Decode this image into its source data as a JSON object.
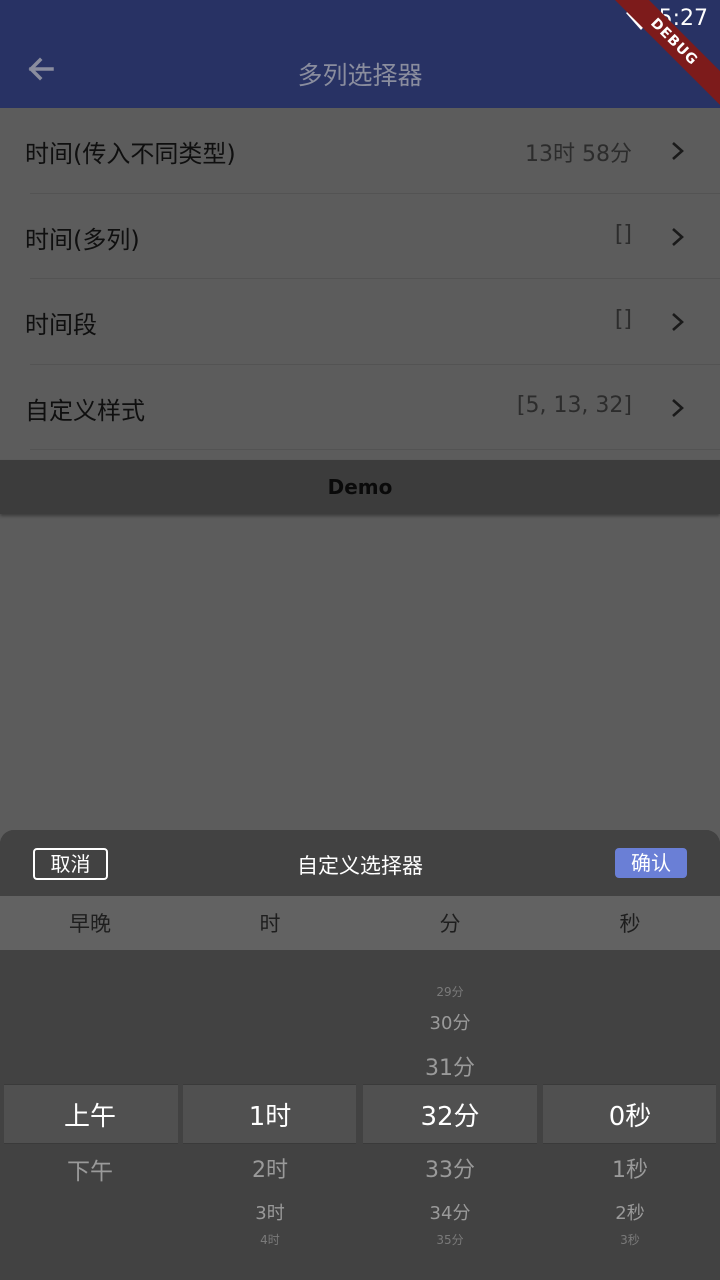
{
  "status_bar": {
    "time": "5:27",
    "debug_label": "DEBUG"
  },
  "app_bar": {
    "title": "多列选择器",
    "back_icon": "arrow-left-icon"
  },
  "list": [
    {
      "label": "时间(传入不同类型)",
      "value": "13时 58分"
    },
    {
      "label": "时间(多列)",
      "value": "[]"
    },
    {
      "label": "时间段",
      "value": "[]"
    },
    {
      "label": "自定义样式",
      "value": "[5, 13, 32]"
    }
  ],
  "demo_button": "Demo",
  "picker": {
    "cancel": "取消",
    "title": "自定义选择器",
    "confirm": "确认",
    "confirm_color": "#6a7fd6",
    "columns": [
      "早晚",
      "时",
      "分",
      "秒"
    ],
    "ampm": {
      "selected": "上午",
      "below1": "下午"
    },
    "hour": {
      "selected": "1时",
      "below1": "2时",
      "below2": "3时",
      "below3": "4时"
    },
    "minute": {
      "above3": "29分",
      "above2": "30分",
      "above1": "31分",
      "selected": "32分",
      "below1": "33分",
      "below2": "34分",
      "below3": "35分"
    },
    "second": {
      "selected": "0秒",
      "below1": "1秒",
      "below2": "2秒",
      "below3": "3秒"
    }
  }
}
